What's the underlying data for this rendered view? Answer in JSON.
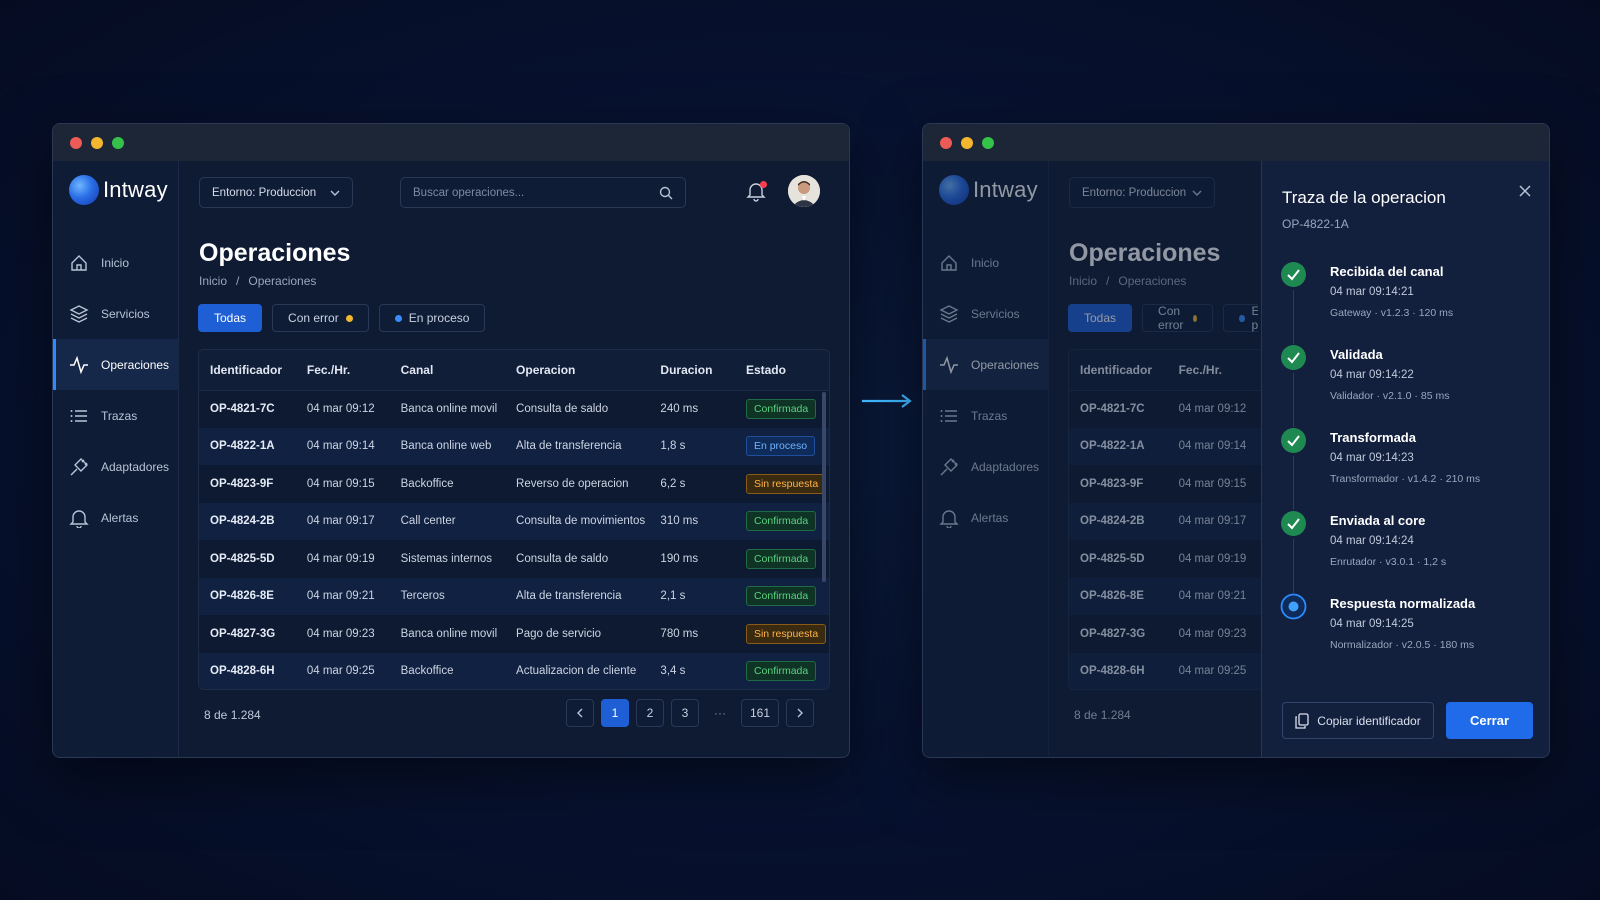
{
  "brand": {
    "name": "Intway"
  },
  "left": {
    "env_select": "Entorno: Produccion",
    "search_placeholder": "Buscar operaciones...",
    "nav": [
      {
        "label": "Inicio",
        "icon": "home-icon"
      },
      {
        "label": "Servicios",
        "icon": "layers-icon"
      },
      {
        "label": "Operaciones",
        "icon": "activity-icon",
        "active": true
      },
      {
        "label": "Trazas",
        "icon": "list-icon"
      },
      {
        "label": "Adaptadores",
        "icon": "plug-icon"
      },
      {
        "label": "Alertas",
        "icon": "bell-icon"
      }
    ],
    "page_title": "Operaciones",
    "breadcrumb": [
      "Inicio",
      "/",
      "Operaciones"
    ],
    "tabs": [
      {
        "label": "Todas",
        "active": true
      },
      {
        "label": "Con error",
        "dot": "#f2b72f"
      },
      {
        "label": "En proceso",
        "dot": "#3b8cff"
      }
    ],
    "columns": [
      "Identificador",
      "Fec./Hr.",
      "Canal",
      "Operacion",
      "Duracion",
      "Estado"
    ],
    "rows": [
      [
        "OP-4821-7C",
        "04 mar 09:12",
        "Banca online movil",
        "Consulta de saldo",
        "240 ms",
        "Confirmada"
      ],
      [
        "OP-4822-1A",
        "04 mar 09:14",
        "Banca online web",
        "Alta de transferencia",
        "1,8 s",
        "En proceso"
      ],
      [
        "OP-4823-9F",
        "04 mar 09:15",
        "Backoffice",
        "Reverso de operacion",
        "6,2 s",
        "Sin respuesta"
      ],
      [
        "OP-4824-2B",
        "04 mar 09:17",
        "Call center",
        "Consulta de movimientos",
        "310 ms",
        "Confirmada"
      ],
      [
        "OP-4825-5D",
        "04 mar 09:19",
        "Sistemas internos",
        "Consulta de saldo",
        "190 ms",
        "Confirmada"
      ],
      [
        "OP-4826-8E",
        "04 mar 09:21",
        "Terceros",
        "Alta de transferencia",
        "2,1 s",
        "Confirmada"
      ],
      [
        "OP-4827-3G",
        "04 mar 09:23",
        "Banca online movil",
        "Pago de servicio",
        "780 ms",
        "Sin respuesta"
      ],
      [
        "OP-4828-6H",
        "04 mar 09:25",
        "Backoffice",
        "Actualizacion de cliente",
        "3,4 s",
        "Confirmada"
      ]
    ],
    "count": "8 de 1.284",
    "pages": [
      "1",
      "2",
      "3",
      "···",
      "161"
    ]
  },
  "right": {
    "columns": [
      "Identificador",
      "Fec./Hr."
    ],
    "trace": {
      "title": "Traza de la operacion",
      "op_id": "OP-4822-1A",
      "steps": [
        {
          "title": "Recibida del canal",
          "time": "04 mar 09:14:21",
          "meta": "Gateway · v1.2.3 · 120 ms",
          "status": "done"
        },
        {
          "title": "Validada",
          "time": "04 mar 09:14:22",
          "meta": "Validador · v2.1.0 · 85 ms",
          "status": "done"
        },
        {
          "title": "Transformada",
          "time": "04 mar 09:14:23",
          "meta": "Transformador · v1.4.2 · 210 ms",
          "status": "done"
        },
        {
          "title": "Enviada al core",
          "time": "04 mar 09:14:24",
          "meta": "Enrutador · v3.0.1 · 1,2 s",
          "status": "done"
        },
        {
          "title": "Respuesta normalizada",
          "time": "04 mar 09:14:25",
          "meta": "Normalizador · v2.0.5 · 180 ms",
          "status": "current"
        }
      ],
      "copy_label": "Copiar identificador",
      "close_label": "Cerrar"
    }
  },
  "colors": {
    "accent": "#1f5fd6",
    "confirmed": "#59d37f",
    "in_process": "#6fb4ff",
    "no_response": "#ffb347"
  }
}
